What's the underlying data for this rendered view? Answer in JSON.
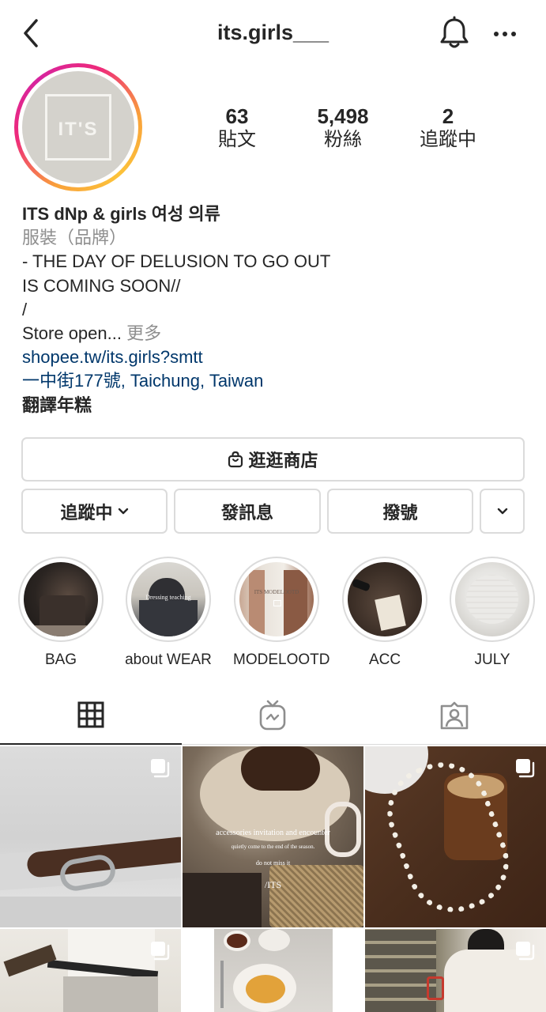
{
  "header": {
    "username": "its.girls___",
    "icons": {
      "back": "chevron-left-icon",
      "notifications": "bell-icon",
      "more": "more-horizontal-icon"
    }
  },
  "profile": {
    "avatar_text": "IT'S",
    "stats": [
      {
        "value": "63",
        "label": "貼文"
      },
      {
        "value": "5,498",
        "label": "粉絲"
      },
      {
        "value": "2",
        "label": "追蹤中"
      }
    ]
  },
  "bio": {
    "name": "ITS dNp & girls 여성 의류",
    "category": "服裝（品牌）",
    "lines": [
      "- THE DAY OF DELUSION TO GO OUT",
      "IS COMING SOON//",
      "/"
    ],
    "truncated_line": "Store open...",
    "more_label": "更多",
    "link": "shopee.tw/its.girls?smtt",
    "address": "一中街177號, Taichung, Taiwan",
    "translate_label": "翻譯年糕"
  },
  "buttons": {
    "shop": "逛逛商店",
    "following": "追蹤中",
    "message": "發訊息",
    "call": "撥號"
  },
  "highlights": [
    {
      "label": "BAG"
    },
    {
      "label": "about WEAR",
      "overlay": "Dressing teaching"
    },
    {
      "label": "MODELOOTD",
      "overlay": "ITS MODELOOTD"
    },
    {
      "label": "ACC"
    },
    {
      "label": "JULY"
    }
  ],
  "tabs": [
    "grid-icon",
    "igtv-icon",
    "tagged-icon"
  ],
  "posts": {
    "post2_overlay": {
      "line1": "accessories invitation and encounter",
      "line2": "quietly come to the end of the season.",
      "line3": "do not miss it",
      "line4": "/ITS"
    }
  },
  "colors": {
    "text": "#262626",
    "secondary": "#8e8e8e",
    "link": "#00376b",
    "border": "#dbdbdb"
  }
}
